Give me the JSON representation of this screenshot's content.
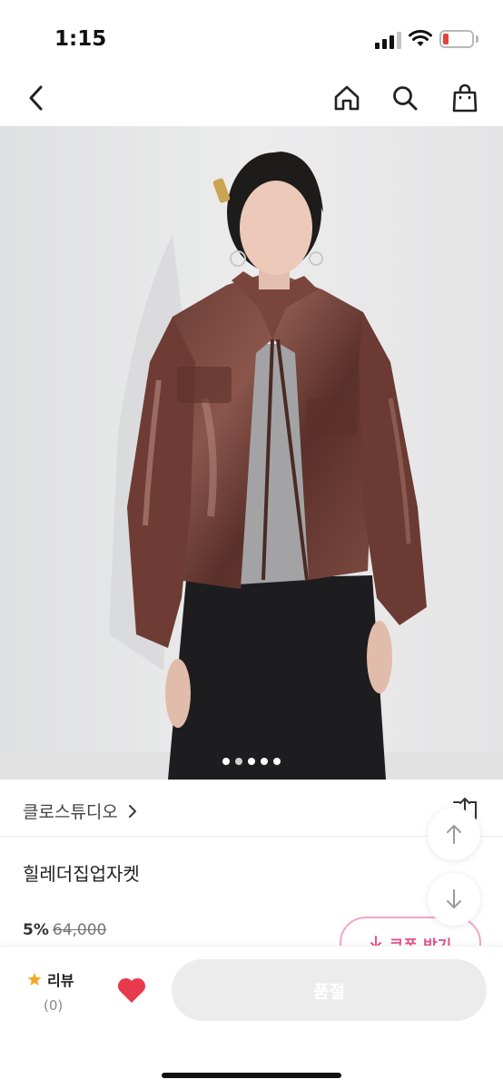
{
  "status": {
    "time": "1:15",
    "battery": "11"
  },
  "product": {
    "brand": "클로스튜디오",
    "name": "힐레더집업자켓",
    "discount": "5%",
    "original_price": "64,000",
    "coupon_label": "쿠폰 받기",
    "image_count": 5,
    "active_image": 2
  },
  "bottom": {
    "review_label": "리뷰",
    "review_count": "(0)",
    "soldout_label": "품절"
  },
  "colors": {
    "accent_pink": "#e8548f",
    "heart_red": "#e73b4d",
    "star_orange": "#f5a623",
    "battery_red": "#e0443a",
    "soldout_gray": "#ececec"
  },
  "icons": [
    "back-icon",
    "home-icon",
    "search-icon",
    "bag-icon",
    "chevron-right-icon",
    "share-icon",
    "arrow-up-icon",
    "arrow-down-icon",
    "star-icon",
    "heart-icon"
  ]
}
